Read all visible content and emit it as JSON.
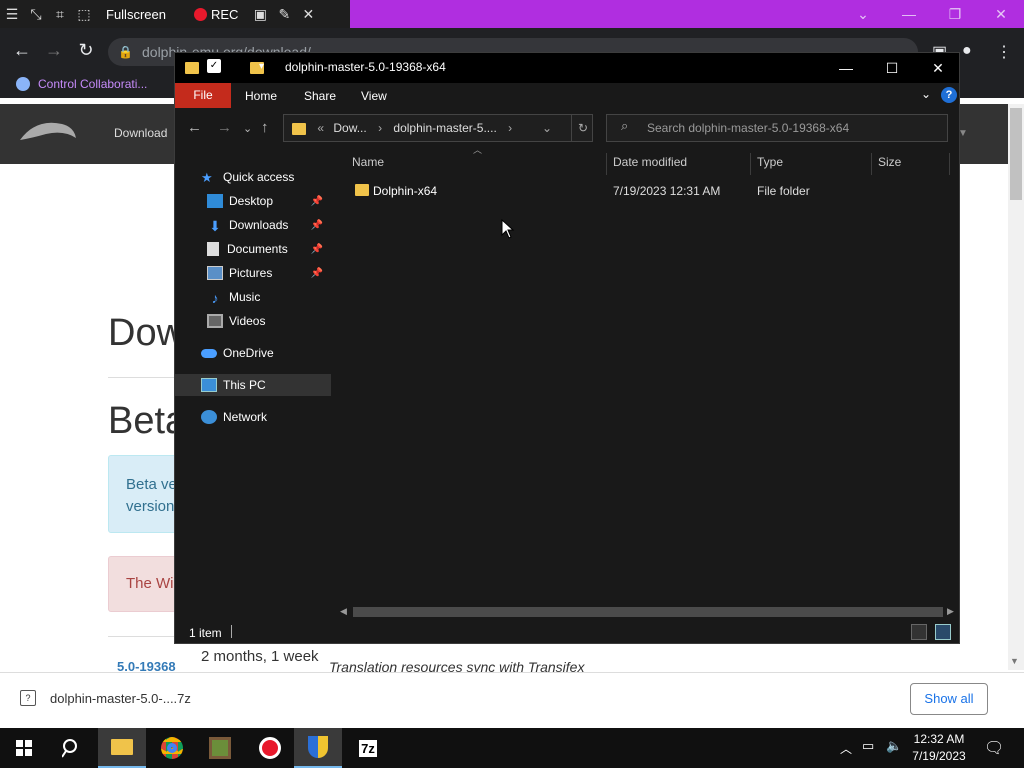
{
  "recorder": {
    "fullscreen_label": "Fullscreen",
    "rec_label": "REC"
  },
  "browser": {
    "url": "dolphin-emu.org/download/",
    "bookmark": "Control Collaborati..."
  },
  "website": {
    "nav_download": "Download",
    "heading_partial": "Dow",
    "beta_heading_partial": "Beta",
    "beta_notice_partial": "Beta ve version",
    "beta_notice_line1": "Beta ve",
    "beta_notice_line2": "version",
    "warning_partial": "The Wi",
    "version_link": "5.0-19368",
    "version_date": "2 months, 1 week",
    "version_desc": "Translation resources sync with Transifex"
  },
  "download_bar": {
    "file_name": "dolphin-master-5.0-....7z",
    "show_all": "Show all"
  },
  "taskbar": {
    "time": "12:32 AM",
    "date": "7/19/2023"
  },
  "explorer": {
    "title": "dolphin-master-5.0-19368-x64",
    "ribbon_tabs": [
      "File",
      "Home",
      "Share",
      "View"
    ],
    "address_parts": [
      "Dow...",
      "dolphin-master-5...."
    ],
    "search_placeholder": "Search dolphin-master-5.0-19368-x64",
    "nav_items": [
      {
        "label": "Quick access",
        "icon": "star-icon",
        "pinned": false
      },
      {
        "label": "Desktop",
        "icon": "desktop-icon",
        "pinned": true
      },
      {
        "label": "Downloads",
        "icon": "download-icon",
        "pinned": true
      },
      {
        "label": "Documents",
        "icon": "documents-icon",
        "pinned": true
      },
      {
        "label": "Pictures",
        "icon": "pictures-icon",
        "pinned": true
      },
      {
        "label": "Music",
        "icon": "music-icon",
        "pinned": false
      },
      {
        "label": "Videos",
        "icon": "videos-icon",
        "pinned": false
      },
      {
        "label": "OneDrive",
        "icon": "cloud-icon",
        "pinned": false
      },
      {
        "label": "This PC",
        "icon": "pc-icon",
        "pinned": false,
        "selected": true
      },
      {
        "label": "Network",
        "icon": "network-icon",
        "pinned": false
      }
    ],
    "columns": [
      "Name",
      "Date modified",
      "Type",
      "Size"
    ],
    "files": [
      {
        "name": "Dolphin-x64",
        "date_modified": "7/19/2023 12:31 AM",
        "type": "File folder",
        "size": ""
      }
    ],
    "status": "1 item"
  }
}
